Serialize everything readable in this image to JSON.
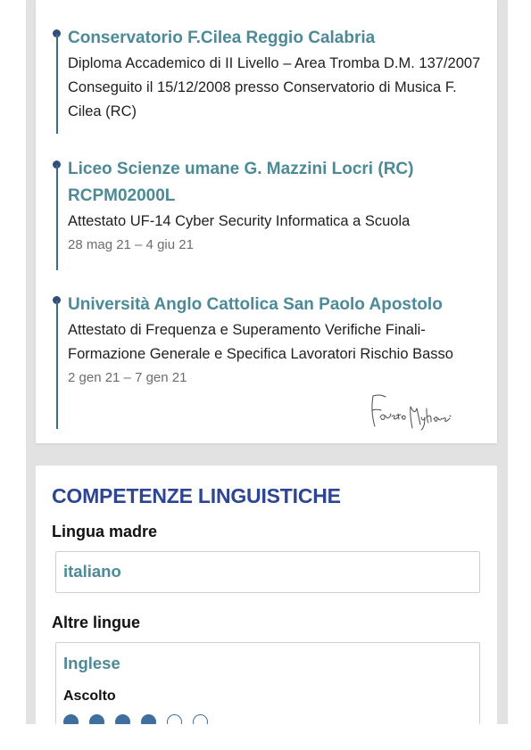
{
  "education": [
    {
      "title": "Conservatorio F.Cilea Reggio Calabria",
      "description": "Diploma Accademico di II Livello – Area Tromba D.M. 137/2007 Conseguito il 15/12/2008 presso Conservatorio di Musica F. Cilea (RC)",
      "date": ""
    },
    {
      "title": "Liceo Scienze umane G. Mazzini Locri (RC) RCPM02000L",
      "description": "Attestato UF-14 Cyber Security Informatica a Scuola",
      "date": "28 mag 21 – 4 giu 21"
    },
    {
      "title": "Università Anglo Cattolica San Paolo Apostolo",
      "description": "Attestato di Frequenza e Superamento Verifiche Finali- Formazione Generale e Specifica Lavoratori Rischio Basso",
      "date": "2 gen 21 – 7 gen 21"
    }
  ],
  "signature_text": "Fausto Mufuraci",
  "languages": {
    "section_title": "COMPETENZE LINGUISTICHE",
    "mother_tongue_label": "Lingua madre",
    "mother_tongue": "italiano",
    "other_languages_label": "Altre lingue",
    "other": [
      {
        "name": "Inglese",
        "skill_label": "Ascolto",
        "level": 4,
        "max_level": 6
      }
    ]
  },
  "colors": {
    "title_teal": "#4b8a96",
    "section_blue": "#2e4594",
    "timeline": "#3d6d84",
    "dot_blue": "#3f6f9c"
  }
}
